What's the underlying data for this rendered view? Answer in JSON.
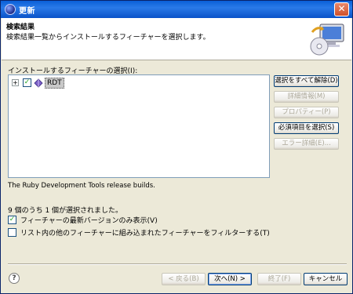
{
  "window": {
    "title": "更新"
  },
  "header": {
    "title": "検索結果",
    "description": "検索結果一覧からインストールするフィーチャーを選択します。"
  },
  "section": {
    "label": "インストールするフィーチャーの選択(I):"
  },
  "tree": {
    "items": [
      {
        "label": "RDT",
        "checked": true,
        "expander": "+"
      }
    ]
  },
  "right_buttons": {
    "deselect_all": "選択をすべて解除(D)",
    "more_info": "詳細情報(M)",
    "properties": "プロパティー(P)",
    "select_required": "必須項目を選択(S)",
    "error_details": "エラー詳細(E)..."
  },
  "description_text": "The Ruby Development Tools release builds.",
  "selection_count": "9 個のうち 1 個が選択されました。",
  "options": [
    {
      "label": "フィーチャーの最新バージョンのみ表示(V)",
      "checked": true
    },
    {
      "label": "リスト内の他のフィーチャーに組み込まれたフィーチャーをフィルターする(T)",
      "checked": false
    }
  ],
  "footer": {
    "help_icon": "?",
    "back": "< 戻る(B)",
    "next": "次へ(N) >",
    "finish": "終了(F)",
    "cancel": "キャンセル"
  },
  "colors": {
    "titlebar": "#0a52c8",
    "window_bg": "#ece9d8",
    "check": "#21a121"
  }
}
